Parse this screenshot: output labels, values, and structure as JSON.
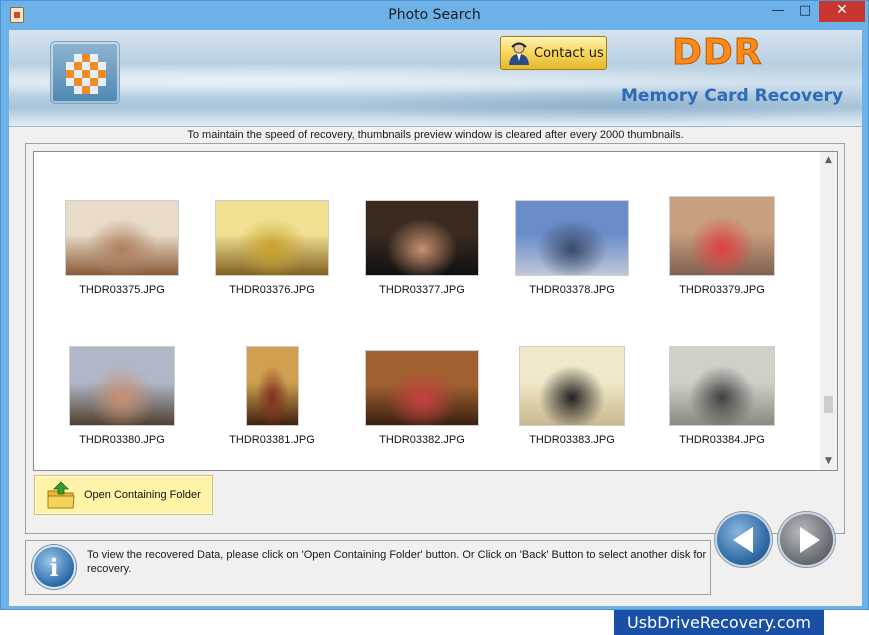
{
  "window": {
    "title": "Photo Search",
    "minimize_glyph": "—",
    "maximize_glyph": "□",
    "close_glyph": "✕"
  },
  "banner": {
    "contact_label": "Contact us",
    "brand": "DDR",
    "product": "Memory Card Recovery"
  },
  "notice": "To maintain the speed of recovery, thumbnails preview window is cleared after every 2000 thumbnails.",
  "thumbnails": [
    {
      "name": "THDR03375.JPG",
      "colors": [
        "#e8dcc8",
        "#b08060",
        "#8a5a3a"
      ]
    },
    {
      "name": "THDR03376.JPG",
      "colors": [
        "#f0e090",
        "#c8a030",
        "#806020"
      ]
    },
    {
      "name": "THDR03377.JPG",
      "colors": [
        "#3a2a20",
        "#c89070",
        "#101010"
      ]
    },
    {
      "name": "THDR03378.JPG",
      "colors": [
        "#6a8cc8",
        "#3a4a6a",
        "#c0c8d8"
      ]
    },
    {
      "name": "THDR03379.JPG",
      "colors": [
        "#c8a080",
        "#e04040",
        "#806050"
      ]
    },
    {
      "name": "THDR03380.JPG",
      "colors": [
        "#b0b8c8",
        "#c89070",
        "#504030"
      ]
    },
    {
      "name": "THDR03381.JPG",
      "colors": [
        "#d0a050",
        "#803020",
        "#402010"
      ]
    },
    {
      "name": "THDR03382.JPG",
      "colors": [
        "#a06030",
        "#c84040",
        "#3a2010"
      ]
    },
    {
      "name": "THDR03383.JPG",
      "colors": [
        "#f0e8c8",
        "#202020",
        "#c8b890"
      ]
    },
    {
      "name": "THDR03384.JPG",
      "colors": [
        "#d0d0c8",
        "#404040",
        "#8a8a80"
      ]
    }
  ],
  "open_folder_label": "Open Containing Folder",
  "status_text": "To view the recovered Data, please click on 'Open Containing Folder' button. Or Click on 'Back' Button to select another disk for recovery.",
  "footer_badge": "UsbDriveRecovery.com",
  "colors": {
    "title_bar": "#6cb2e8",
    "close_button": "#c7372f",
    "brand_orange": "#ff8a1a",
    "product_blue": "#2c6bb8",
    "highlight_button": "#fff3a8",
    "footer_badge": "#1a4fa8"
  },
  "scroll": {
    "up_glyph": "▲",
    "down_glyph": "▼",
    "position": 0.85
  }
}
